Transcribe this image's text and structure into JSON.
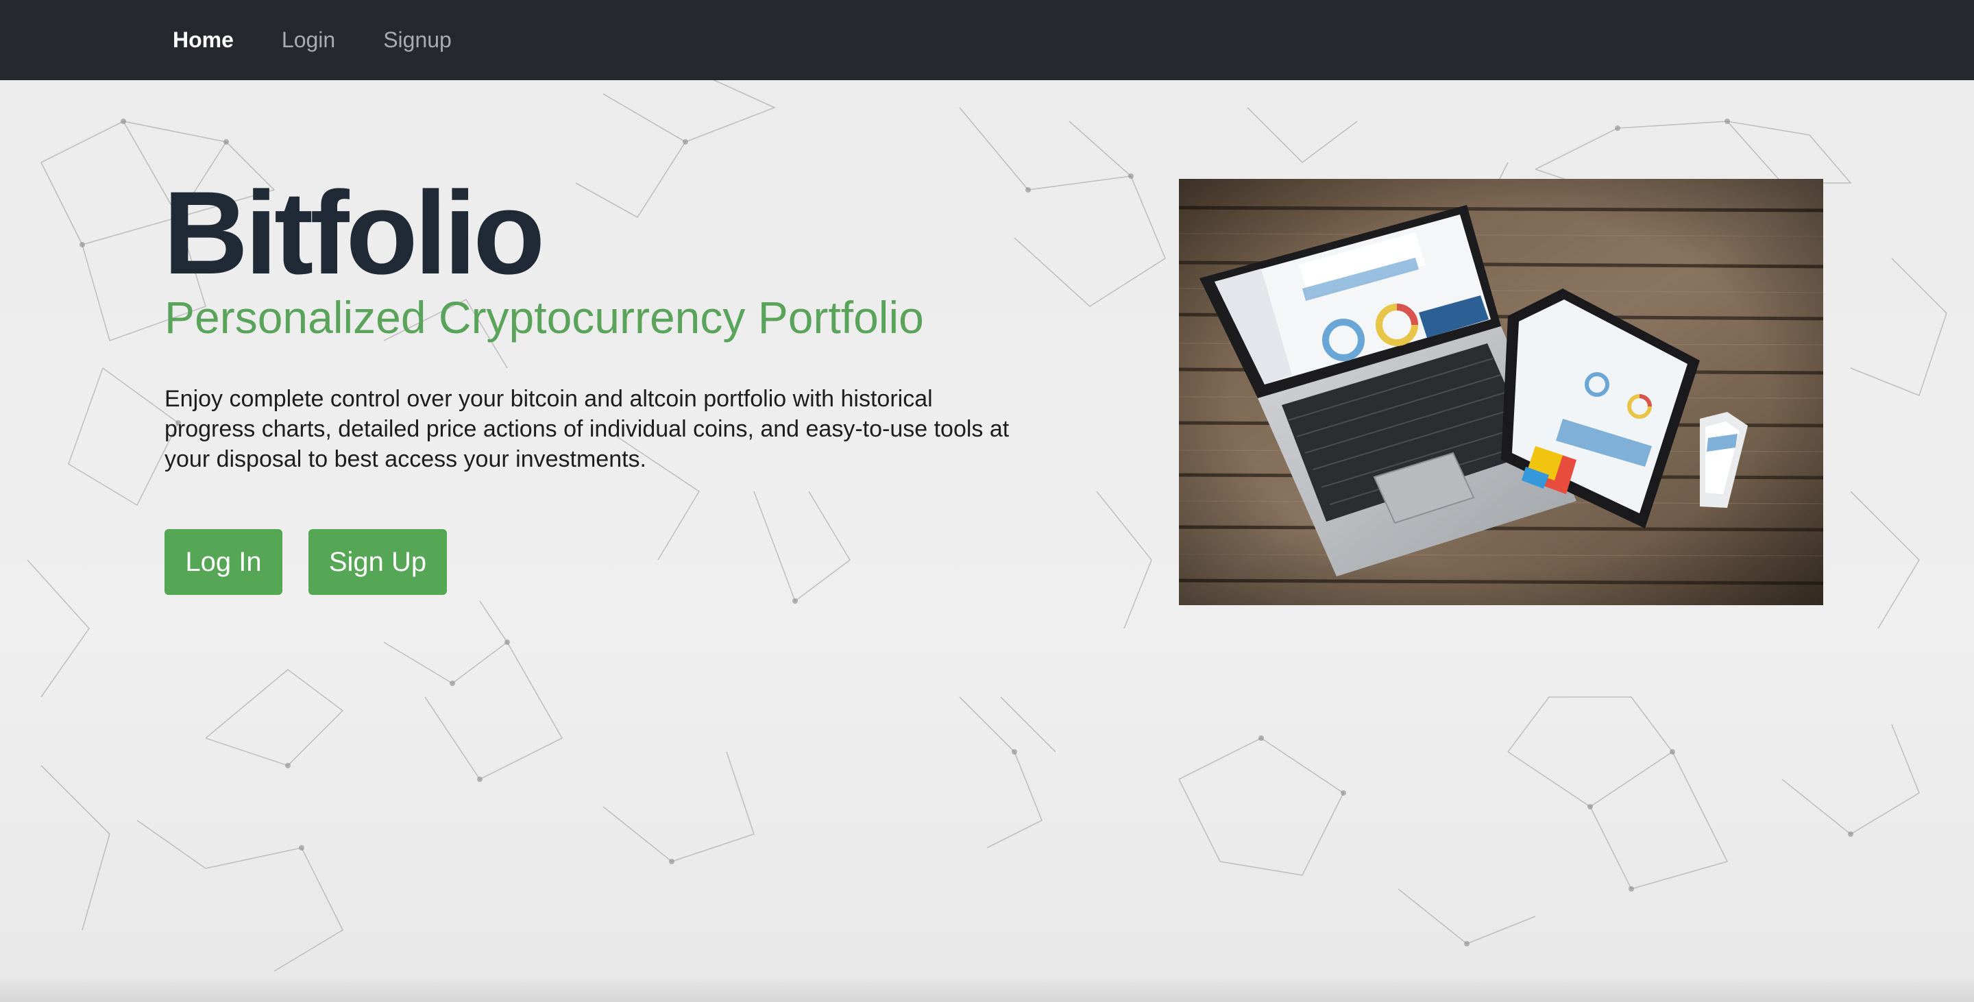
{
  "nav": {
    "items": [
      {
        "label": "Home",
        "active": true
      },
      {
        "label": "Login",
        "active": false
      },
      {
        "label": "Signup",
        "active": false
      }
    ]
  },
  "hero": {
    "title": "Bitfolio",
    "tagline": "Personalized Cryptocurrency Portfolio",
    "description": "Enjoy complete control over your bitcoin and altcoin portfolio with historical progress charts, detailed price actions of individual coins, and easy-to-use tools at your disposal to best access your investments.",
    "login_button": "Log In",
    "signup_button": "Sign Up"
  },
  "colors": {
    "navbar_bg": "#25282c",
    "title": "#1f2a36",
    "accent_green": "#5aa35a",
    "button_green": "#55a655"
  }
}
